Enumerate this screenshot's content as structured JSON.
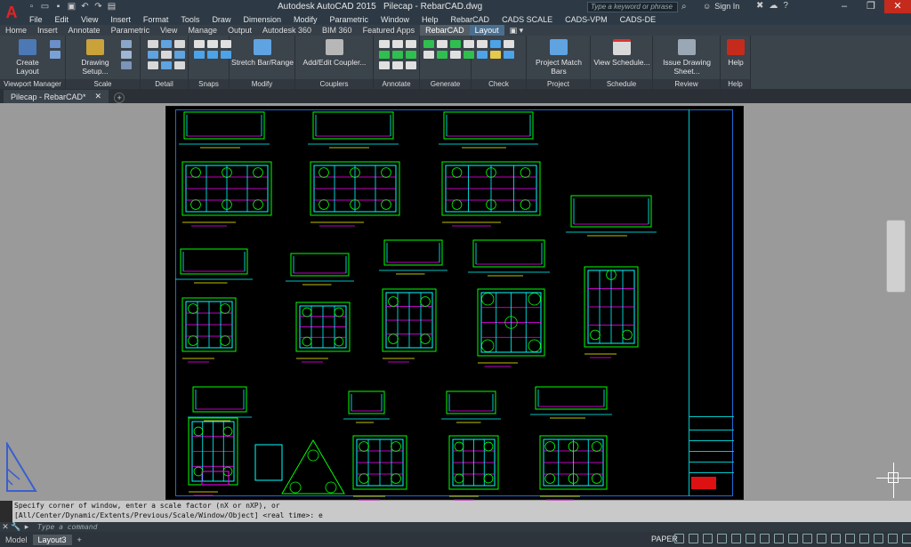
{
  "title_bar": {
    "app_name": "Autodesk AutoCAD 2015",
    "file_name": "Pilecap - RebarCAD.dwg",
    "search_placeholder": "Type a keyword or phrase",
    "sign_in": "Sign In"
  },
  "menu": [
    "File",
    "Edit",
    "View",
    "Insert",
    "Format",
    "Tools",
    "Draw",
    "Dimension",
    "Modify",
    "Parametric",
    "Window",
    "Help",
    "RebarCAD",
    "CADS SCALE",
    "CADS-VPM",
    "CADS-DE"
  ],
  "ribbon_tabs": [
    "Home",
    "Insert",
    "Annotate",
    "Parametric",
    "View",
    "Manage",
    "Output",
    "Autodesk 360",
    "BIM 360",
    "Featured Apps",
    "RebarCAD",
    "Layout"
  ],
  "ribbon": {
    "create_layout": "Create Layout",
    "drawing_setup": "Drawing Setup...",
    "stretch_bar": "Stretch Bar/Range",
    "add_edit_coupler": "Add/Edit Coupler...",
    "project_match_bars": "Project Match Bars",
    "view_schedule": "View Schedule...",
    "issue_drawing_sheet": "Issue Drawing Sheet...",
    "help": "Help",
    "panels": [
      "Viewport Manager",
      "Scale",
      "Detail",
      "Snaps",
      "Modify",
      "Couplers",
      "Annotate",
      "Generate",
      "Check",
      "Project",
      "Schedule",
      "Review",
      "Help"
    ]
  },
  "doc_tabs": [
    {
      "label": "Pilecap - RebarCAD*"
    }
  ],
  "command": {
    "history_line1": "Specify corner of window, enter a scale factor (nX or nXP), or",
    "history_line2": "[All/Center/Dynamic/Extents/Previous/Scale/Window/Object] <real time>: e",
    "placeholder": "Type a command"
  },
  "status": {
    "layout_tabs": [
      "Model",
      "Layout3"
    ],
    "space": "PAPER"
  },
  "colors": {
    "title_bg": "#2d3a46",
    "ribbon_bg": "#3b434b",
    "canvas_bg": "#9a9a9a",
    "paper_bg": "#000000",
    "drawing_green": "#00ff00",
    "drawing_cyan": "#00ffff",
    "drawing_magenta": "#ff00ff",
    "drawing_yellow": "#ffff00"
  }
}
